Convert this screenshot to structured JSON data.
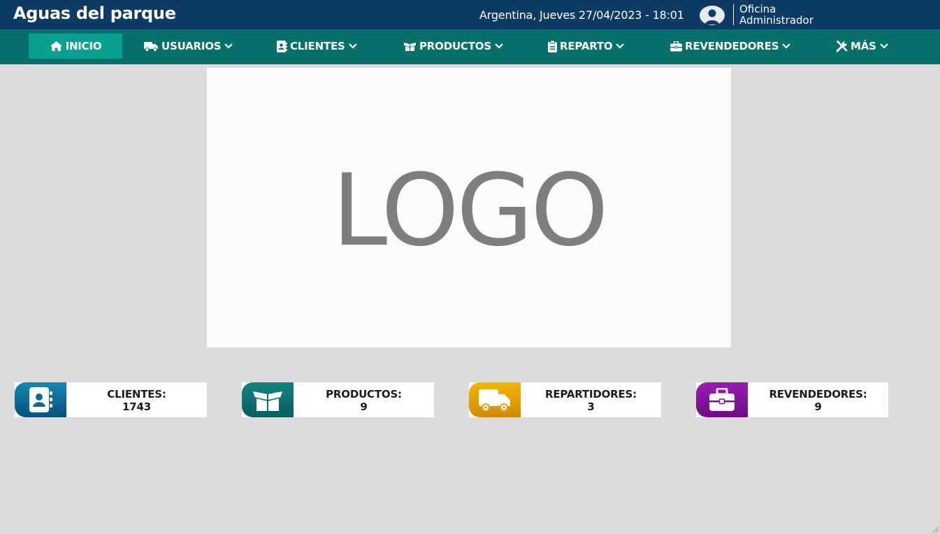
{
  "header": {
    "brand": "Aguas del parque",
    "datetime": "Argentina, Jueves 27/04/2023 - 18:01",
    "user_line1": "Oficina",
    "user_line2": "Administrador"
  },
  "nav": {
    "items": [
      {
        "label": "INICIO",
        "icon": "home-icon",
        "active": true
      },
      {
        "label": "USUARIOS",
        "icon": "truck-icon",
        "dropdown": true
      },
      {
        "label": "CLIENTES",
        "icon": "address-book-icon",
        "dropdown": true
      },
      {
        "label": "PRODUCTOS",
        "icon": "box-open-icon",
        "dropdown": true
      },
      {
        "label": "REPARTO",
        "icon": "clipboard-icon",
        "dropdown": true
      },
      {
        "label": "REVENDEDORES",
        "icon": "briefcase-icon",
        "dropdown": true
      },
      {
        "label": "MÁS",
        "icon": "tools-icon",
        "dropdown": true
      }
    ]
  },
  "logo": {
    "text": "LOGO"
  },
  "stats": [
    {
      "label": "CLIENTES:",
      "value": "1743",
      "icon": "address-book-icon",
      "color": "#0e6a8f"
    },
    {
      "label": "PRODUCTOS:",
      "value": "9",
      "icon": "box-open-icon",
      "color": "#0d6f70"
    },
    {
      "label": "REPARTIDORES:",
      "value": "3",
      "icon": "truck-icon",
      "color": "#e6a000"
    },
    {
      "label": "REVENDEDORES:",
      "value": "9",
      "icon": "briefcase-icon",
      "color": "#7a1390"
    }
  ],
  "colors": {
    "topbar": "#0d3b63",
    "navbar": "#08706a",
    "nav_active": "#0aa090",
    "background": "#dcdcdc"
  }
}
